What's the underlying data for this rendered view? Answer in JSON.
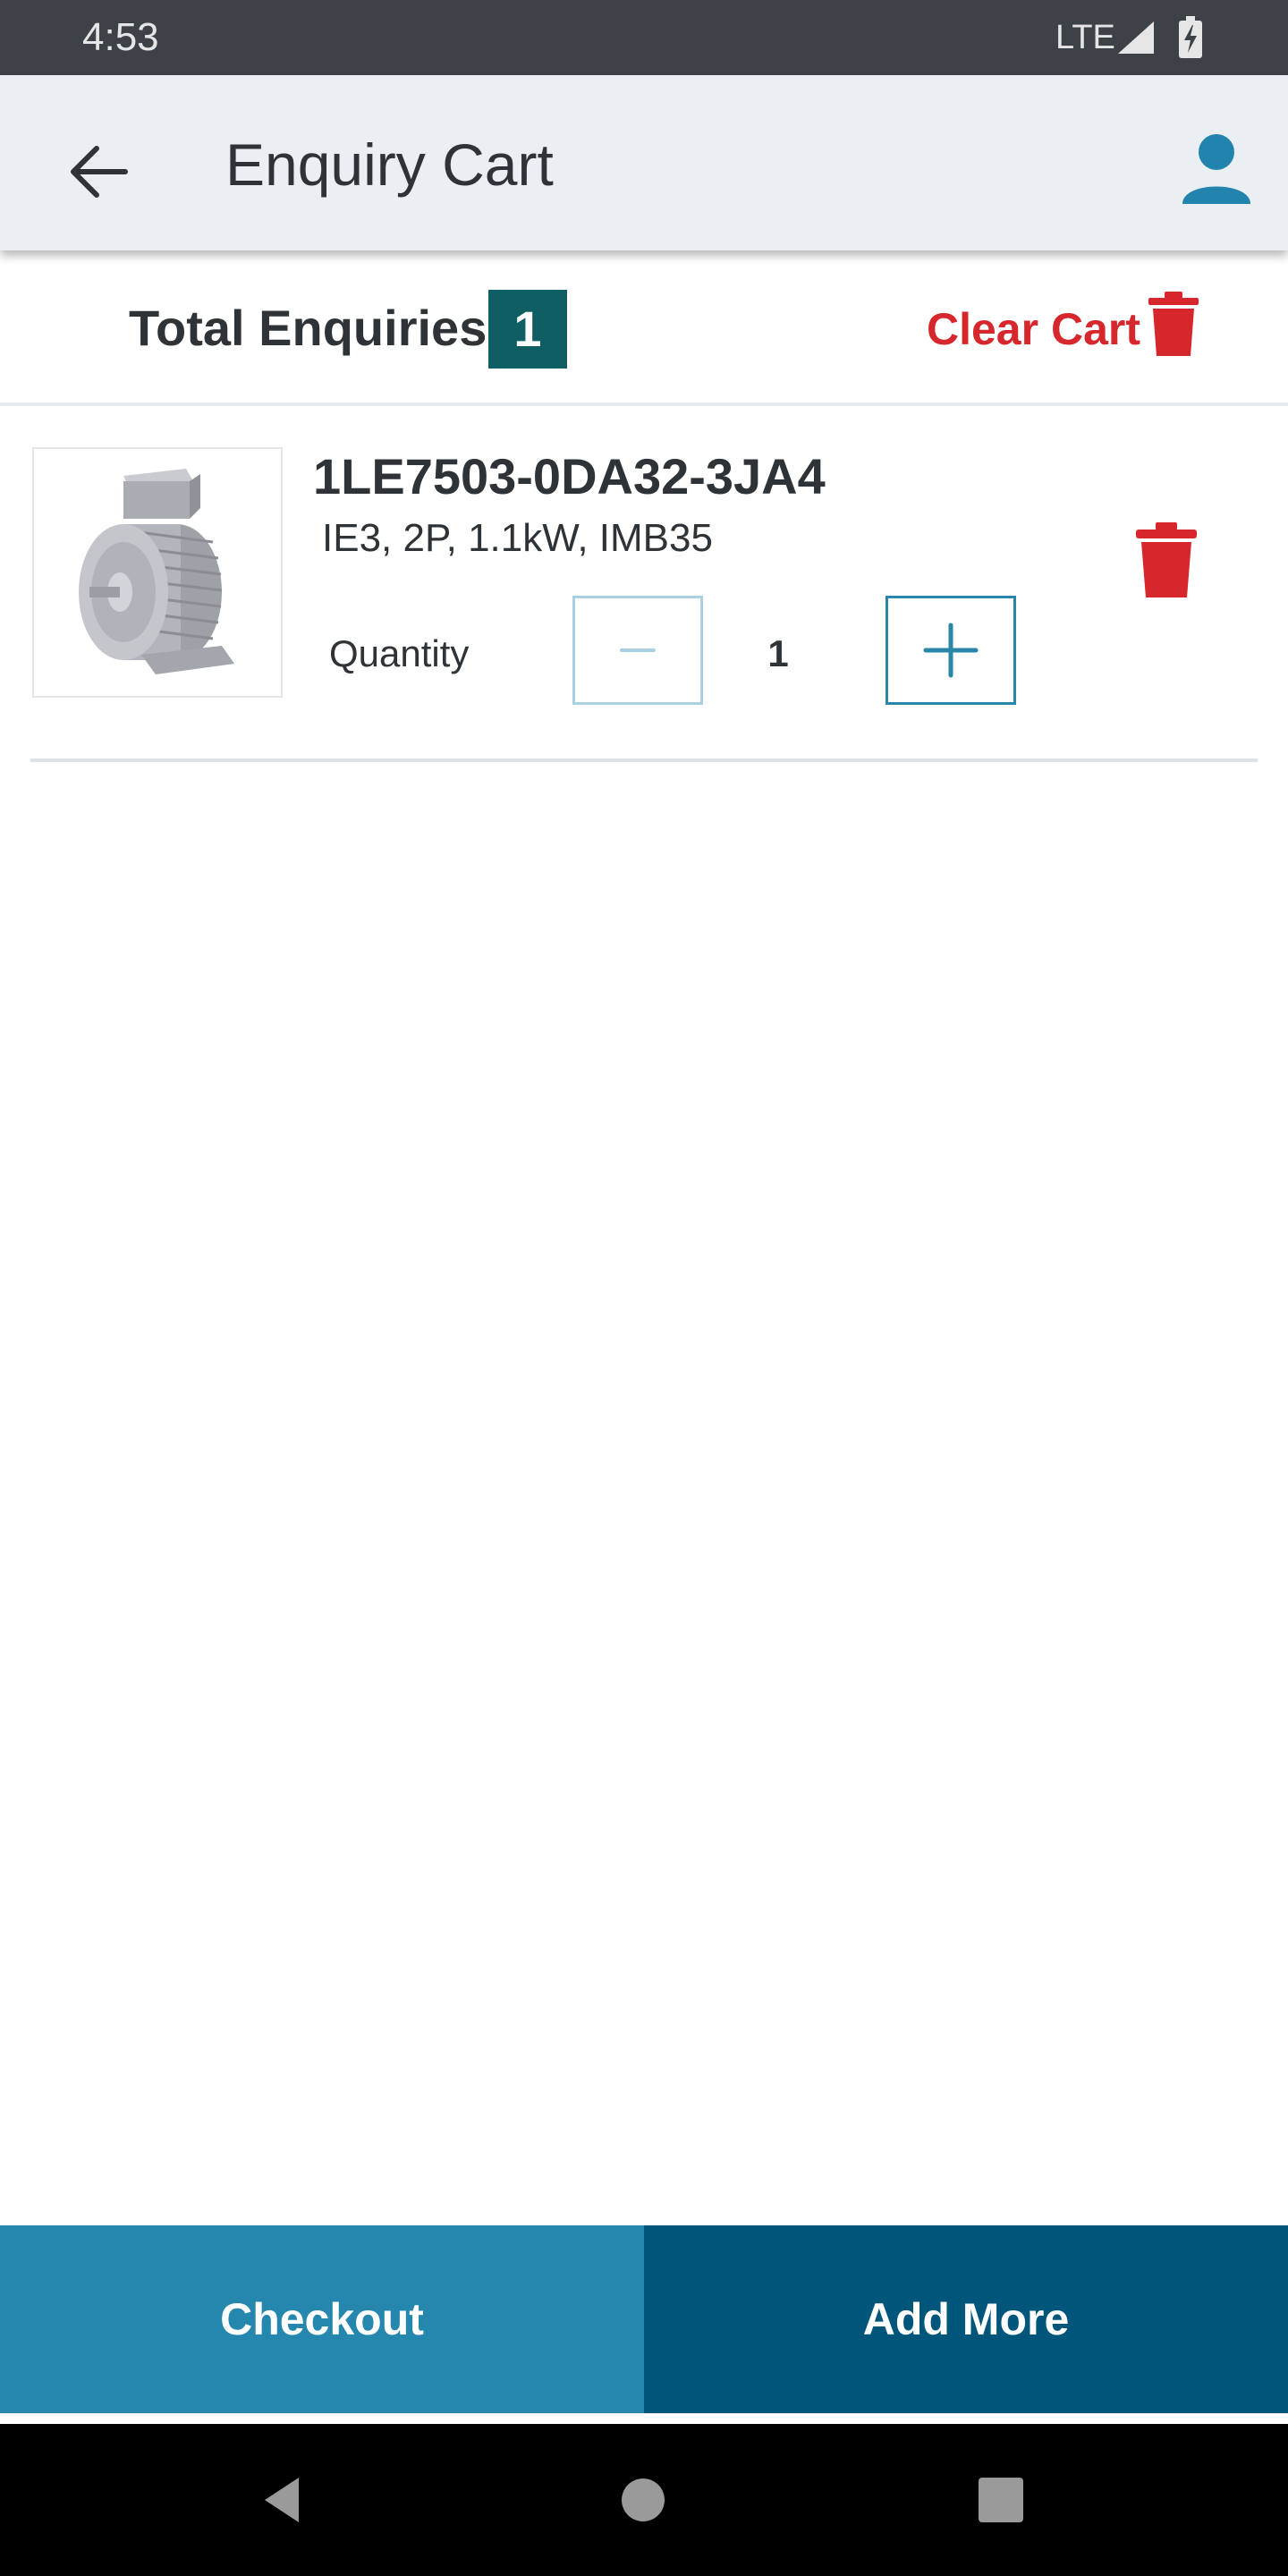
{
  "status_bar": {
    "time": "4:53",
    "network": "LTE",
    "icons": [
      "signal-icon",
      "battery-charging-icon"
    ]
  },
  "app_bar": {
    "title": "Enquiry Cart",
    "back_icon": "arrow-left-icon",
    "profile_icon": "person-icon"
  },
  "summary": {
    "total_label": "Total Enquiries:",
    "total_count": "1",
    "clear_label": "Clear Cart",
    "clear_icon": "trash-icon"
  },
  "cart_items": [
    {
      "code": "1LE7503-0DA32-3JA4",
      "spec": "IE3, 2P, 1.1kW, IMB35",
      "quantity_label": "Quantity",
      "quantity": "1",
      "image_icon": "electric-motor-icon",
      "delete_icon": "trash-icon"
    }
  ],
  "actions": {
    "checkout_label": "Checkout",
    "add_more_label": "Add More"
  },
  "nav": {
    "icons": [
      "nav-back-icon",
      "nav-home-icon",
      "nav-recents-icon"
    ]
  },
  "colors": {
    "status_bar": "#3d4248",
    "app_bar": "#eaeff4",
    "badge": "#0f5e63",
    "danger": "#d6272d",
    "accent": "#2587ad",
    "accent_dark": "#00557a",
    "increment_border": "#2a86a8",
    "decrement_border": "#a8d0e0",
    "profile": "#2283ad"
  }
}
